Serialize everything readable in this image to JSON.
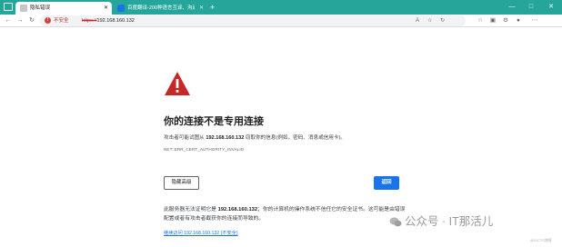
{
  "browser": {
    "tabs": [
      {
        "title": "隐私错误",
        "active": true
      },
      {
        "title": "百度翻译-200种语言互译、沟通...",
        "active": false
      }
    ],
    "new_tab": "+",
    "window_controls": [
      "—",
      "□",
      "✕"
    ],
    "address": {
      "security_label": "不安全",
      "url_scheme": "https://",
      "url_host": "192.168.160.132"
    }
  },
  "error_page": {
    "heading": "你的连接不是专用连接",
    "description_prefix": "攻击者可能试图从",
    "description_host": "192.168.160.132",
    "description_suffix": "窃取你的信息(例如，密码、消息或信用卡)。",
    "error_code": "NET::ERR_CERT_AUTHORITY_INVALID",
    "advanced_button": "隐藏高级",
    "back_button": "返回",
    "detail_prefix": "此服务器无法证明它是",
    "detail_host": "192.168.160.132",
    "detail_suffix": "；你的计算机的操作系统不信任它的安全证书。这可能是由错误配置或者有攻击者截获你的连接而导致的。",
    "proceed_link": "继续访问 192.168.160.132 (不安全)"
  },
  "watermark": {
    "text": "公众号 · IT那活儿",
    "corner": "@51CTO博客"
  },
  "colors": {
    "tabbar": "#26a69a",
    "danger": "#c62828",
    "primary": "#1a73e8"
  }
}
